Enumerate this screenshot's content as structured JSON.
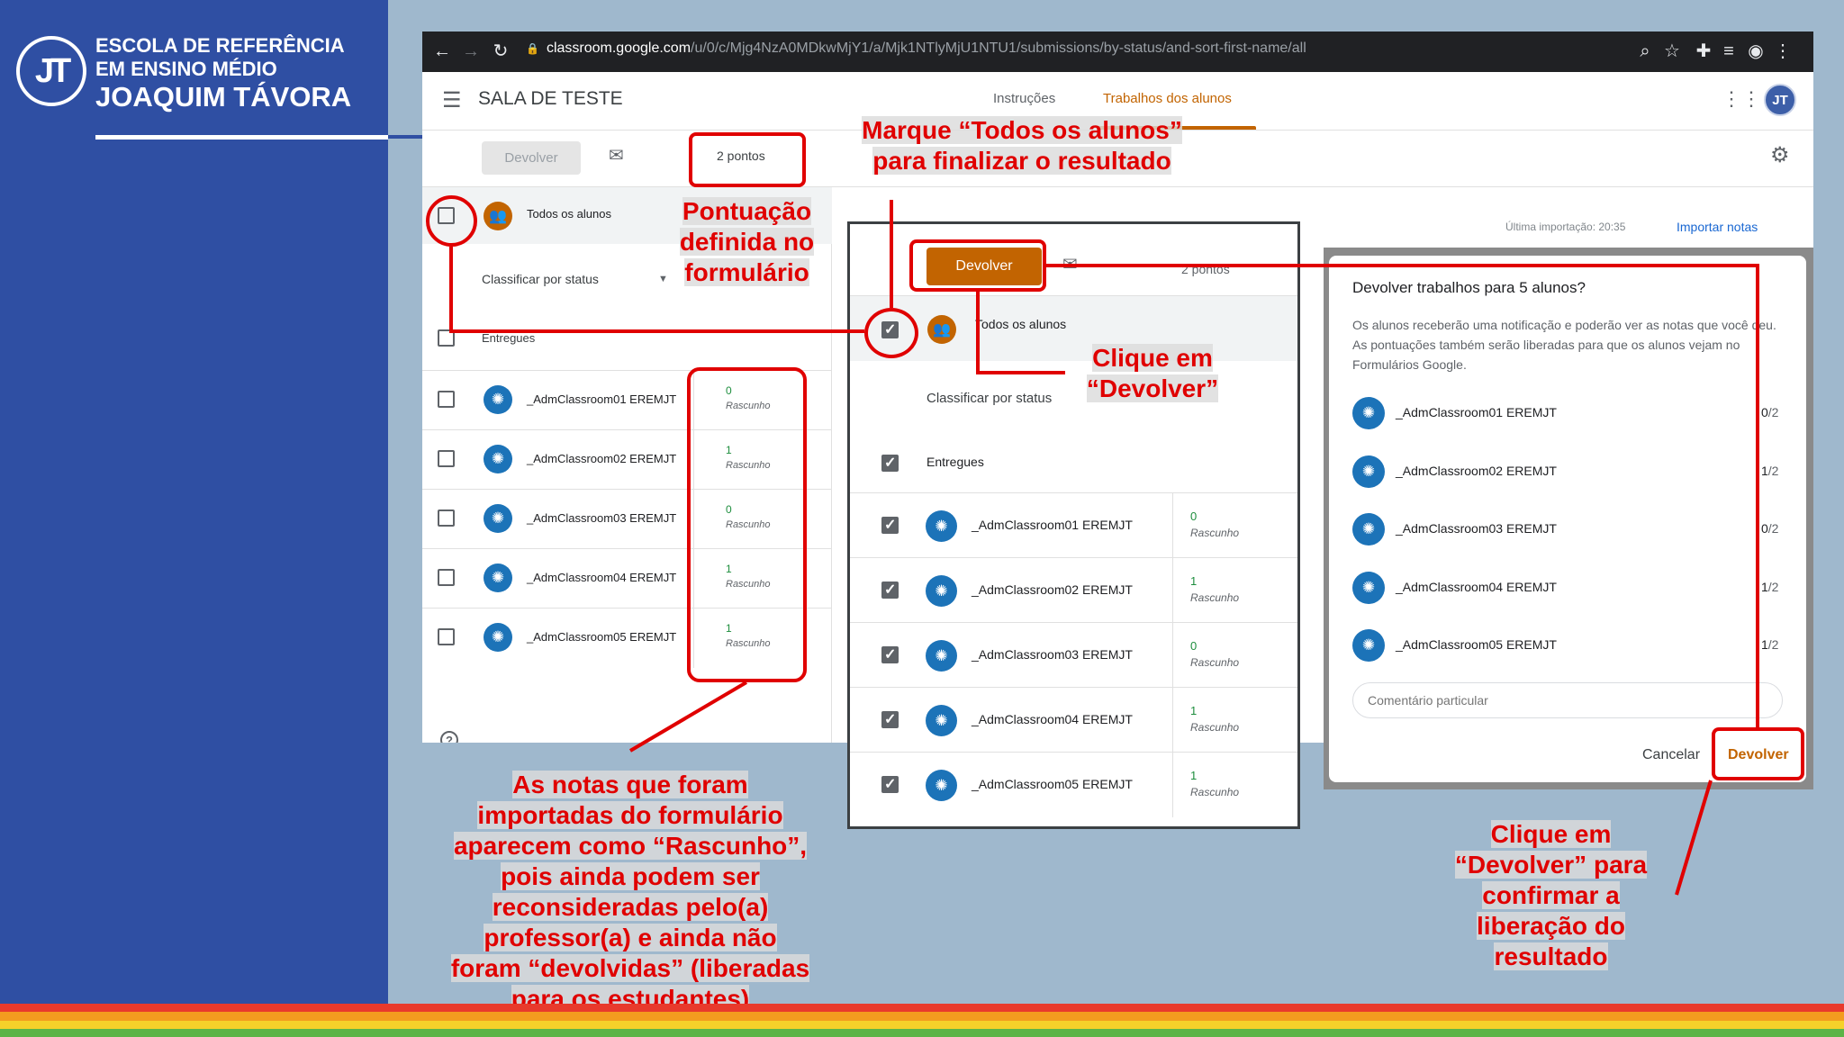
{
  "branding": {
    "logo_text": "JT",
    "line1": "ESCOLA DE REFERÊNCIA",
    "line2": "EM ENSINO MÉDIO",
    "line3": "JOAQUIM TÁVORA"
  },
  "browser": {
    "url_host": "classroom.google.com",
    "url_path": "/u/0/c/Mjg4NzA0MDkwMjY1/a/Mjk1NTlyMjU1NTU1/submissions/by-status/and-sort-first-name/all"
  },
  "app": {
    "class_title": "SALA DE TESTE",
    "tabs": [
      "Instruções",
      "Trabalhos dos alunos"
    ],
    "avatar_initials": "JT"
  },
  "actionbar": {
    "return_label": "Devolver",
    "points": "2 pontos"
  },
  "list": {
    "all_students": "Todos os alunos",
    "sort_label": "Classificar por status",
    "delivered": "Entregues",
    "status_draft": "Rascunho",
    "students": [
      {
        "name": "_AdmClassroom01 EREMJT",
        "grade": "0"
      },
      {
        "name": "_AdmClassroom02 EREMJT",
        "grade": "1"
      },
      {
        "name": "_AdmClassroom03 EREMJT",
        "grade": "0"
      },
      {
        "name": "_AdmClassroom04 EREMJT",
        "grade": "1"
      },
      {
        "name": "_AdmClassroom05 EREMJT",
        "grade": "1"
      }
    ]
  },
  "background": {
    "last_import": "Última importação: 20:35",
    "import_button": "Importar notas"
  },
  "dialog": {
    "title": "Devolver trabalhos para 5 alunos?",
    "body": "Os alunos receberão uma notificação e poderão ver as notas que você deu. As pontuações também serão liberadas para que os alunos vejam no Formulários Google.",
    "max_score": "/2",
    "comment_placeholder": "Comentário particular",
    "cancel_label": "Cancelar",
    "return_label": "Devolver"
  },
  "annotations": {
    "select_all": "Marque “Todos os alunos” para finalizar o resultado",
    "score_defined": "Pontuação definida no formulário",
    "click_return": "Clique em “Devolver”",
    "drafts_note": "As notas que foram importadas do formulário aparecem como “Rascunho”, pois ainda podem ser reconsideradas pelo(a) professor(a) e ainda não foram “devolvidas” (liberadas para os estudantes)",
    "confirm_return": "Clique em “Devolver” para confirmar a liberação do resultado"
  },
  "colors": {
    "accent_orange": "#c26401",
    "annotation_red": "#e00000",
    "panel_blue": "#2f4fa3"
  }
}
